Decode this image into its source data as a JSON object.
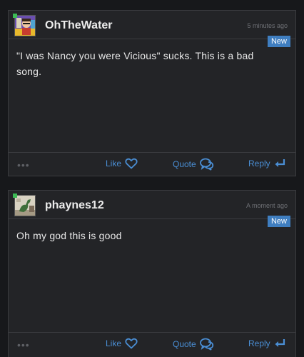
{
  "posts": [
    {
      "username": "OhTheWater",
      "timestamp": "5 minutes ago",
      "badge": "New",
      "body": "\"I was Nancy you were Vicious\" sucks. This is a bad song.",
      "avatar_icon": "cartoon-avatar-icon",
      "actions": {
        "like": "Like",
        "quote": "Quote",
        "reply": "Reply",
        "more": "•••"
      }
    },
    {
      "username": "phaynes12",
      "timestamp": "A moment ago",
      "badge": "New",
      "body": "Oh my god this is good",
      "avatar_icon": "dinosaur-avatar-icon",
      "actions": {
        "like": "Like",
        "quote": "Quote",
        "reply": "Reply",
        "more": "•••"
      }
    }
  ],
  "colors": {
    "background": "#17181b",
    "card": "#232427",
    "accent": "#4a8ed4",
    "badge": "#3f7ec0",
    "online": "#3cba54"
  }
}
